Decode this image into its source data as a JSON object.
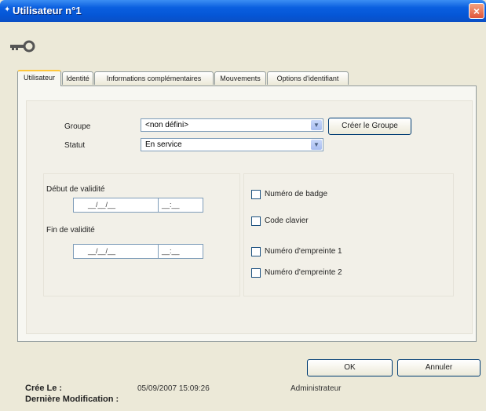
{
  "window": {
    "title": "Utilisateur n°1",
    "title_icon": "star-icon",
    "close_label": "×"
  },
  "toolbar": {
    "key_icon": "key-icon"
  },
  "tabs": [
    {
      "label": "Utilisateur",
      "active": true
    },
    {
      "label": "Identité",
      "active": false
    },
    {
      "label": "Informations complémentaires",
      "active": false
    },
    {
      "label": "Mouvements",
      "active": false
    },
    {
      "label": "Options d'identifiant",
      "active": false
    }
  ],
  "form": {
    "groupe_label": "Groupe",
    "groupe_value": "<non défini>",
    "create_group_button": "Créer le Groupe",
    "statut_label": "Statut",
    "statut_value": "En service",
    "debut_label": "Début de validité",
    "debut_date": "__/__/__",
    "debut_time": "__:__",
    "fin_label": "Fin de validité",
    "fin_date": "__/__/__",
    "fin_time": "__:__",
    "checkboxes": [
      {
        "label": "Numéro de badge",
        "checked": false
      },
      {
        "label": "Code clavier",
        "checked": false
      },
      {
        "label": "Numéro d'empreinte 1",
        "checked": false
      },
      {
        "label": "Numéro d'empreinte 2",
        "checked": false
      }
    ]
  },
  "buttons": {
    "ok": "OK",
    "cancel": "Annuler"
  },
  "footer": {
    "created_label": "Crée Le :",
    "created_value": "05/09/2007 15:09:26",
    "created_by": "Administrateur",
    "modified_label": "Dernière Modification :"
  },
  "colors": {
    "titlebar": "#0556d6",
    "close": "#e0553a",
    "background": "#ece9d8",
    "tab_highlight": "#ffc73c"
  }
}
